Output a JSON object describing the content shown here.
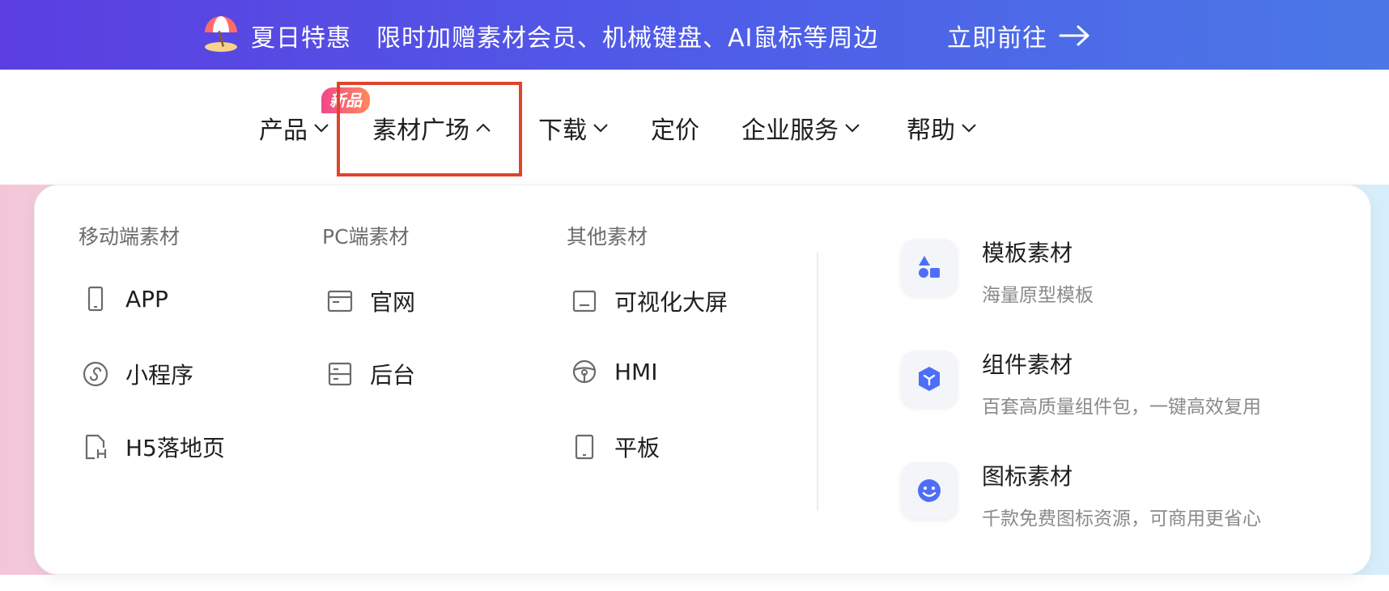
{
  "banner": {
    "promo_title": "夏日特惠",
    "promo_desc": "限时加赠素材会员、机械键盘、AI鼠标等周边",
    "cta_label": "立即前往",
    "icon": "beach-umbrella-icon",
    "colors": {
      "start": "#5b3ee0",
      "end": "#4a78e6"
    }
  },
  "nav": {
    "items": [
      {
        "label": "产品",
        "has_chevron": true
      },
      {
        "label": "素材广场",
        "has_chevron": true,
        "expanded": true
      },
      {
        "label": "下载",
        "has_chevron": true
      },
      {
        "label": "定价",
        "has_chevron": false
      },
      {
        "label": "企业服务",
        "has_chevron": true
      },
      {
        "label": "帮助",
        "has_chevron": true
      }
    ],
    "new_badge": "新品",
    "highlight_color": "#e0442c"
  },
  "dropdown": {
    "columns": [
      {
        "title": "移动端素材",
        "items": [
          {
            "label": "APP",
            "icon": "phone-icon"
          },
          {
            "label": "小程序",
            "icon": "mini-program-icon"
          },
          {
            "label": "H5落地页",
            "icon": "h5-file-icon"
          }
        ]
      },
      {
        "title": "PC端素材",
        "items": [
          {
            "label": "官网",
            "icon": "browser-window-icon"
          },
          {
            "label": "后台",
            "icon": "dashboard-icon"
          }
        ]
      },
      {
        "title": "其他素材",
        "items": [
          {
            "label": "可视化大屏",
            "icon": "monitor-icon"
          },
          {
            "label": "HMI",
            "icon": "steering-wheel-icon"
          },
          {
            "label": "平板",
            "icon": "tablet-icon"
          }
        ]
      }
    ],
    "features": [
      {
        "title": "模板素材",
        "desc": "海量原型模板",
        "icon": "shapes-icon"
      },
      {
        "title": "组件素材",
        "desc": "百套高质量组件包，一键高效复用",
        "icon": "cube-icon"
      },
      {
        "title": "图标素材",
        "desc": "千款免费图标资源，可商用更省心",
        "icon": "smiley-icon"
      }
    ],
    "accent_color": "#4f6ef7"
  }
}
